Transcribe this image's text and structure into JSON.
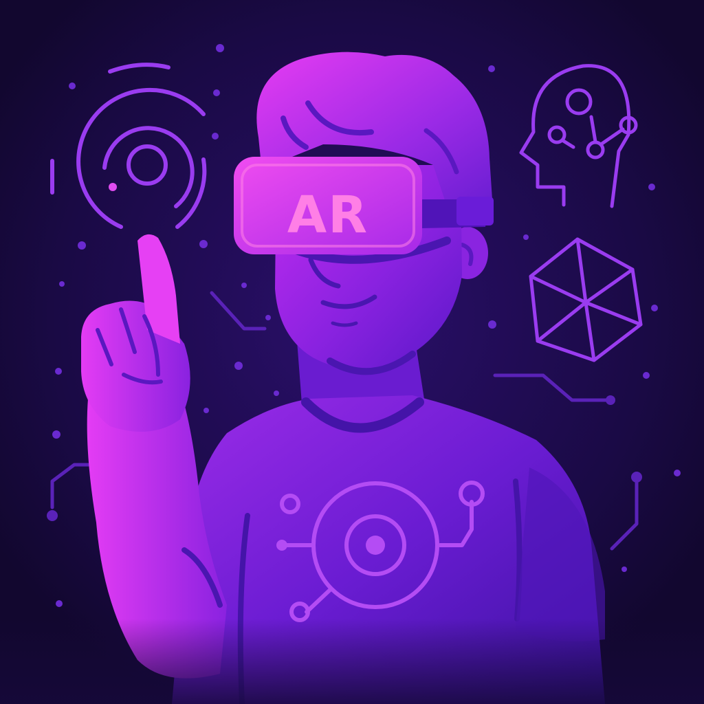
{
  "headset": {
    "label": "AR"
  },
  "icons": [
    "target-rings-icon",
    "brain-network-head-icon",
    "hexagon-cube-icon",
    "chest-target-icon"
  ],
  "colors": {
    "background": "#16093a",
    "accent_pink": "#ff4fd8",
    "accent_purple": "#a32cff",
    "deep_violet": "#4a16b8",
    "line_violet": "#9a3cf0",
    "text": "#ff7fe6"
  }
}
